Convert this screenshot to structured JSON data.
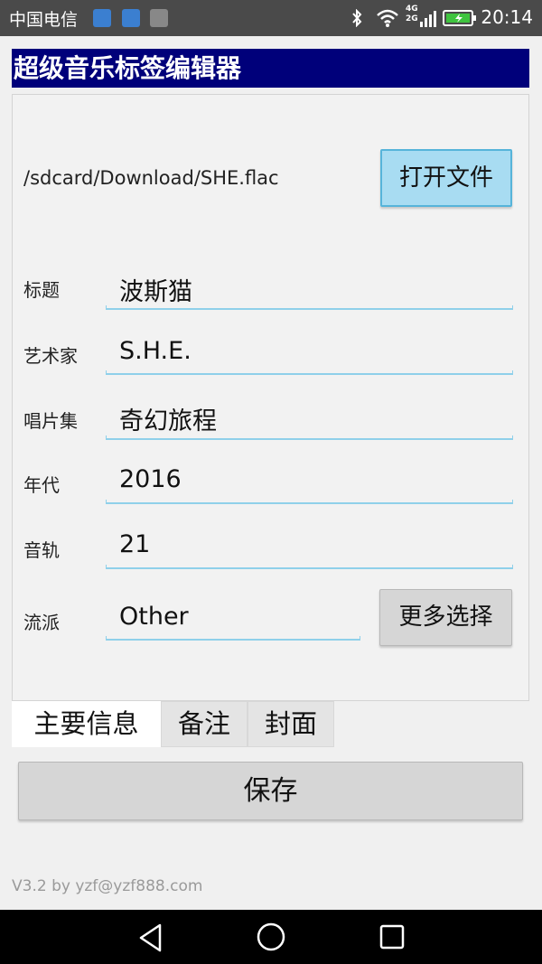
{
  "status_bar": {
    "carrier": "中国电信",
    "network": "4G 2G",
    "time": "20:14",
    "icons": [
      "notification-icon-1",
      "usb-icon",
      "image-icon",
      "bluetooth-icon",
      "wifi-icon",
      "signal-icon",
      "battery-charging-icon"
    ]
  },
  "app": {
    "title": "超级音乐标签编辑器"
  },
  "file": {
    "path": "/sdcard/Download/SHE.flac",
    "open_button": "打开文件"
  },
  "fields": [
    {
      "label": "标题",
      "value": "波斯猫"
    },
    {
      "label": "艺术家",
      "value": "S.H.E."
    },
    {
      "label": "唱片集",
      "value": "奇幻旅程"
    },
    {
      "label": "年代",
      "value": "2016"
    },
    {
      "label": "音轨",
      "value": "21"
    },
    {
      "label": "流派",
      "value": "Other"
    }
  ],
  "more_button": "更多选择",
  "tabs": [
    {
      "label": "主要信息",
      "active": true
    },
    {
      "label": "备注",
      "active": false
    },
    {
      "label": "封面",
      "active": false
    }
  ],
  "save_button": "保存",
  "footer": {
    "version": "V3.2 by  yzf@yzf888.com"
  },
  "colors": {
    "title_bg": "#00007a",
    "open_button_bg": "#a8dcf2",
    "underline": "#8fd0ea"
  }
}
